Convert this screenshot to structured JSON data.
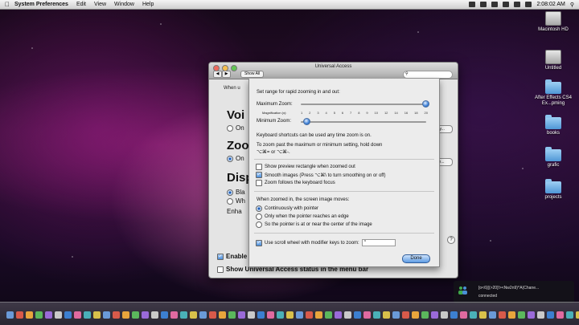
{
  "menubar": {
    "app": "System Preferences",
    "items": [
      "Edit",
      "View",
      "Window",
      "Help"
    ],
    "clock": "2:08:02 AM"
  },
  "desktop": {
    "icons": [
      {
        "label": "Macintosh HD",
        "kind": "hd"
      },
      {
        "label": "Untitled",
        "kind": "hd"
      },
      {
        "label": "After Effects CS4 Ex...pming",
        "kind": "folder"
      },
      {
        "label": "books",
        "kind": "folder"
      },
      {
        "label": "grafic",
        "kind": "folder"
      },
      {
        "label": "projects",
        "kind": "folder"
      }
    ]
  },
  "window": {
    "title": "Universal Access",
    "show_all": "Show All",
    "search_placeholder": "",
    "when_label": "When u",
    "voiceover": {
      "heading": "Voi",
      "option": "On"
    },
    "zoom": {
      "heading": "Zoo",
      "option": "On",
      "options_btn": "ty..."
    },
    "display": {
      "heading": "Disp",
      "opt1": "Bla",
      "opt2": "Wh",
      "enhance": "Enha",
      "options_btn": "e..."
    },
    "enable_label": "Enable",
    "show_status_label": "Show Universal Access status in the menu bar"
  },
  "zoom_sheet": {
    "set_range": "Set range for rapid zooming in and out:",
    "max_zoom_label": "Maximum Zoom:",
    "magnification_label": "Magnification (x):",
    "ticks": [
      "1",
      "2",
      "3",
      "4",
      "5",
      "6",
      "7",
      "8",
      "9",
      "10",
      "12",
      "14",
      "16",
      "18",
      "20"
    ],
    "min_zoom_label": "Minimum Zoom:",
    "max_zoom_value": 20,
    "min_zoom_value": 1,
    "shortcut_note": "Keyboard shortcuts can be used any time zoom is on.",
    "zoom_past_note": "To zoom past the maximum or minimum setting, hold down",
    "zoom_past_keys": "⌥⌘= or ⌥⌘-.",
    "check_preview": "Show preview rectangle when zoomed out",
    "check_smooth": "Smooth images (Press ⌥⌘\\ to turn smoothing on or off)",
    "check_focus": "Zoom follows the keyboard focus",
    "moves_label": "When zoomed in, the screen image moves:",
    "radio_continuous": "Continuously with pointer",
    "radio_edge": "Only when the pointer reaches an edge",
    "radio_center": "So the pointer is at or near the center of the image",
    "scroll_label": "Use scroll wheel with modifier keys to zoom:",
    "scroll_key": "^",
    "done": "Done"
  },
  "notification": {
    "line1": "[o<6)[(>20]!><Nw2n9)^A(Chane...",
    "line2": "connected"
  },
  "colors": {
    "accent": "#3b7fd6",
    "window_bg": "#e4e4e4"
  }
}
